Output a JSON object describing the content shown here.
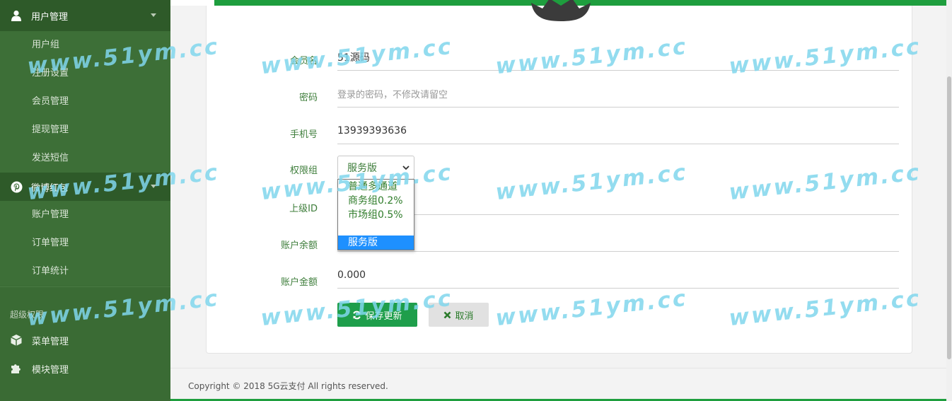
{
  "sidebar": {
    "groups": [
      {
        "label": "用户管理",
        "icon": "user-icon",
        "items": [
          "用户组",
          "注册设置",
          "会员管理",
          "提现管理",
          "发送短信"
        ]
      },
      {
        "label": "微博红包",
        "icon": "pinterest-icon",
        "items": [
          "账户管理",
          "订单管理",
          "订单统计"
        ]
      }
    ],
    "section_label": "超级权限",
    "plain_items": [
      {
        "label": "菜单管理",
        "icon": "cube-icon"
      },
      {
        "label": "模块管理",
        "icon": "puzzle-icon"
      }
    ]
  },
  "form": {
    "username": {
      "label": "会员名",
      "value": "51源码"
    },
    "password": {
      "label": "密码",
      "placeholder": "登录的密码，不修改请留空"
    },
    "phone": {
      "label": "手机号",
      "value": "13939393636"
    },
    "group": {
      "label": "权限组",
      "selected": "服务版"
    },
    "parent_id": {
      "label": "上级ID",
      "value": ""
    },
    "balance": {
      "label": "账户余额",
      "value": ""
    },
    "amount": {
      "label": "账户金额",
      "value": "0.000"
    }
  },
  "dropdown": {
    "options": [
      "普通多通道",
      "商务组0.2%",
      "市场组0.5%",
      "",
      "服务版"
    ],
    "selected_index": 4
  },
  "buttons": {
    "save": "保存更新",
    "cancel": "取消"
  },
  "footer": {
    "copyright": "Copyright © 2018 5G云支付 All rights reserved."
  },
  "watermark": "www.51ym.cc",
  "colors": {
    "sidebar": "#3a6b34",
    "accent": "#1e9e3e",
    "label": "#3d7d3a",
    "selected_option": "#1e90ff"
  }
}
